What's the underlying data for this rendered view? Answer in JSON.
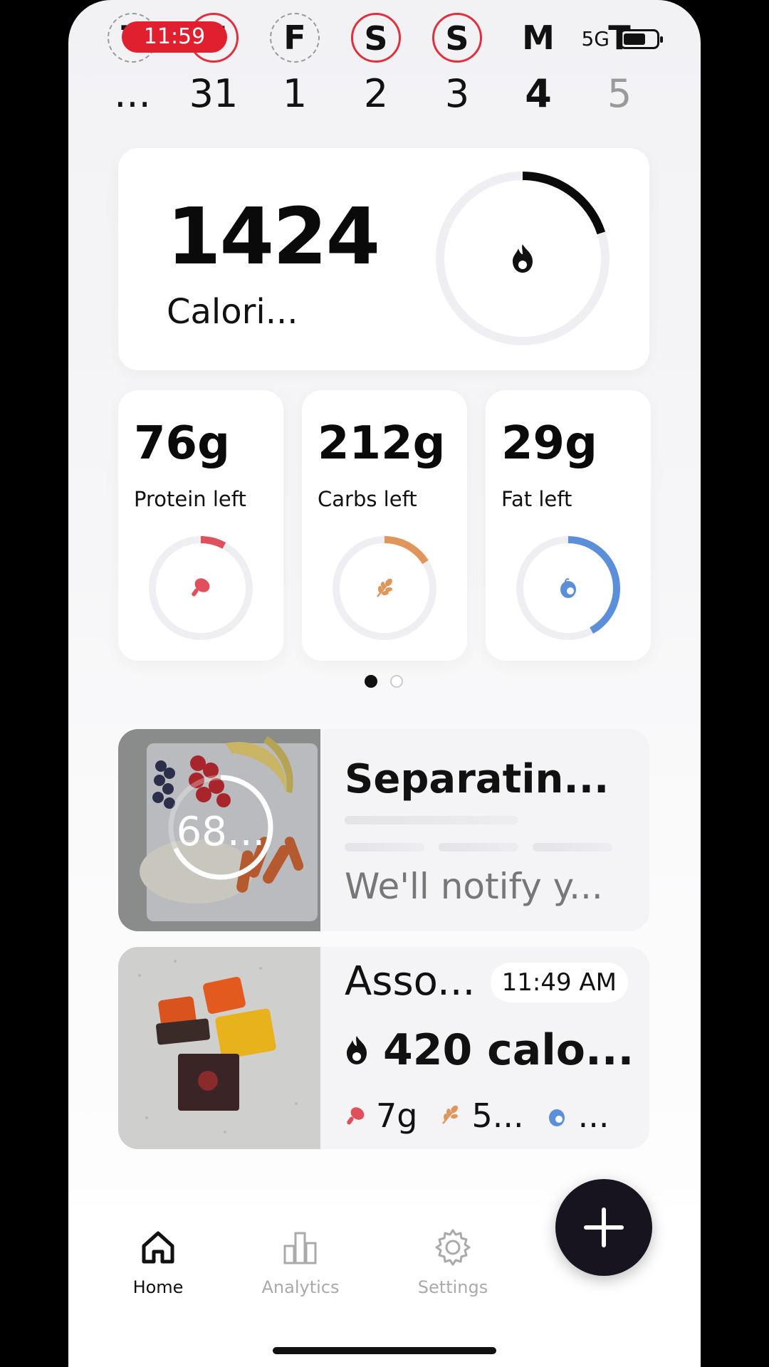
{
  "status_bar": {
    "time": "11:59",
    "network": "5G"
  },
  "week": [
    {
      "letter": "T",
      "num": "...",
      "style": "dashed",
      "state": "past"
    },
    {
      "letter": "T",
      "num": "31",
      "style": "ring",
      "state": "past"
    },
    {
      "letter": "F",
      "num": "1",
      "style": "dashed",
      "state": "past"
    },
    {
      "letter": "S",
      "num": "2",
      "style": "ring",
      "state": "past"
    },
    {
      "letter": "S",
      "num": "3",
      "style": "ring",
      "state": "past"
    },
    {
      "letter": "M",
      "num": "4",
      "style": "none",
      "state": "today"
    },
    {
      "letter": "T",
      "num": "5",
      "style": "none",
      "state": "future"
    }
  ],
  "calories": {
    "value": "1424",
    "label": "Calori...",
    "progress": 0.2,
    "color": "#0a0a0a"
  },
  "macros": [
    {
      "amount": "76g",
      "label": "Protein left",
      "progress": 0.08,
      "color": "#e0505c",
      "icon": "drumstick-icon"
    },
    {
      "amount": "212g",
      "label": "Carbs left",
      "progress": 0.16,
      "color": "#e0955a",
      "icon": "wheat-icon"
    },
    {
      "amount": "29g",
      "label": "Fat left",
      "progress": 0.42,
      "color": "#5b8fd9",
      "icon": "avocado-icon"
    }
  ],
  "pager": {
    "count": 2,
    "active": 0
  },
  "entries": [
    {
      "title": "Separatin...",
      "progress_text": "68...",
      "progress": 0.68,
      "subtitle": "We'll notify y..."
    },
    {
      "title": "Asso...",
      "time": "11:49 AM",
      "calories": "420 calo...",
      "protein": "7g",
      "carbs": "5...",
      "fat": "..."
    }
  ],
  "tabs": [
    {
      "label": "Home",
      "icon": "home-icon",
      "active": true
    },
    {
      "label": "Analytics",
      "icon": "bar-chart-icon",
      "active": false
    },
    {
      "label": "Settings",
      "icon": "gear-icon",
      "active": false
    }
  ]
}
